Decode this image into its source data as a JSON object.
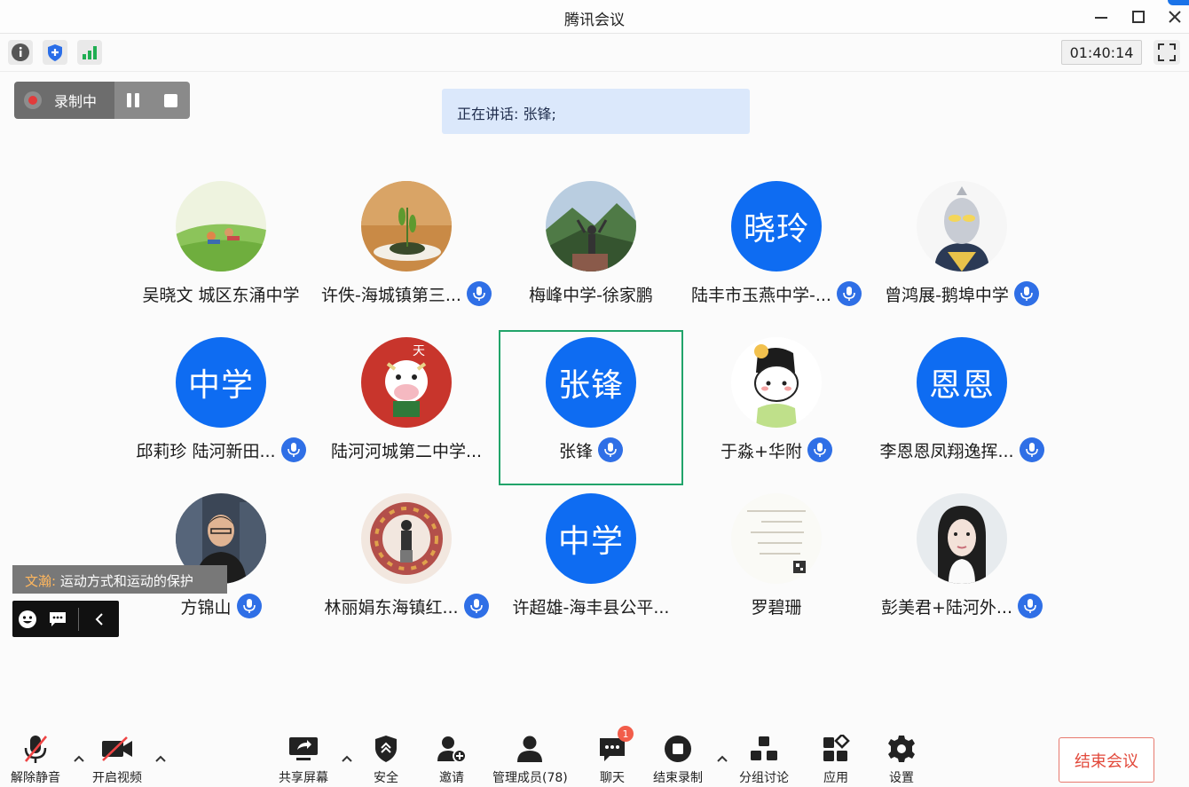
{
  "window": {
    "title": "腾讯会议"
  },
  "toolbar": {
    "timer": "01:40:14"
  },
  "recording": {
    "label": "录制中"
  },
  "speaking": {
    "text": "正在讲话: 张锋;"
  },
  "participants": [
    {
      "name": "吴晓文 城区东涌中学",
      "avatar": "photo-meadow",
      "mic": false
    },
    {
      "name": "许佚-海城镇第三...",
      "avatar": "photo-tea",
      "mic": true
    },
    {
      "name": "梅峰中学-徐家鹏",
      "avatar": "photo-mountain",
      "mic": false
    },
    {
      "name": "陆丰市玉燕中学-...",
      "avatar_text": "晓玲",
      "mic": true
    },
    {
      "name": "曾鸿展-鹅埠中学",
      "avatar": "photo-ultraman",
      "mic": true
    },
    {
      "name": "邱莉珍 陆河新田...",
      "avatar_text": "中学",
      "mic": true
    },
    {
      "name": "陆河河城第二中学...",
      "avatar": "photo-cartoon-cow",
      "mic": false
    },
    {
      "name": "张锋",
      "avatar_text": "张锋",
      "mic": true,
      "speaking": true
    },
    {
      "name": "于淼+华附",
      "avatar": "photo-cartoon-face",
      "mic": true
    },
    {
      "name": "李恩恩凤翔逸挥...",
      "avatar_text": "恩恩",
      "mic": true
    },
    {
      "name": "方锦山",
      "avatar": "photo-man",
      "mic": true
    },
    {
      "name": "林丽娟东海镇红...",
      "avatar": "photo-wreath",
      "mic": true
    },
    {
      "name": "许超雄-海丰县公平...",
      "avatar_text": "中学",
      "mic": false
    },
    {
      "name": "罗碧珊",
      "avatar": "photo-note",
      "mic": false
    },
    {
      "name": "彭美君+陆河外...",
      "avatar": "photo-woman",
      "mic": true
    }
  ],
  "chat": {
    "sender": "文瀚:",
    "message": "运动方式和运动的保护"
  },
  "bottom": {
    "unmute": "解除静音",
    "video": "开启视频",
    "share": "共享屏幕",
    "security": "安全",
    "invite": "邀请",
    "members": "管理成员(78)",
    "chat": "聊天",
    "chat_badge": "1",
    "end_record": "结束录制",
    "breakout": "分组讨论",
    "apps": "应用",
    "settings": "设置",
    "end_meeting": "结束会议"
  },
  "colors": {
    "accent": "#0e6cf2",
    "speaking_border": "#21a46a",
    "end": "#e2493b"
  }
}
